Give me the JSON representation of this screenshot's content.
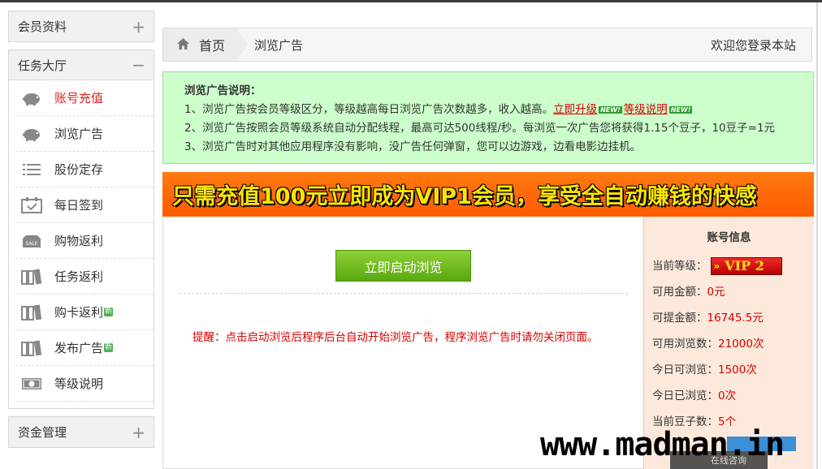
{
  "sidebar": {
    "member_panel": {
      "title": "会员资料",
      "toggle": "+"
    },
    "task_panel": {
      "title": "任务大厅",
      "toggle": "−",
      "items": [
        {
          "label": "账号充值",
          "icon": "piggy-bank-icon",
          "new": ""
        },
        {
          "label": "浏览广告",
          "icon": "piggy-bank-icon",
          "new": ""
        },
        {
          "label": "股份定存",
          "icon": "list-icon",
          "new": ""
        },
        {
          "label": "每日签到",
          "icon": "calendar-check-icon",
          "new": ""
        },
        {
          "label": "购物返利",
          "icon": "sale-tag-icon",
          "new": ""
        },
        {
          "label": "任务返利",
          "icon": "books-icon",
          "new": ""
        },
        {
          "label": "购卡返利",
          "icon": "books-icon",
          "new": "新"
        },
        {
          "label": "发布广告",
          "icon": "books-icon",
          "new": "新"
        },
        {
          "label": "等级说明",
          "icon": "money-bill-icon",
          "new": ""
        }
      ]
    },
    "funds_panel": {
      "title": "资金管理",
      "toggle": "+"
    }
  },
  "breadcrumb": {
    "home": "首页",
    "current": "浏览广告",
    "welcome": "欢迎您登录本站"
  },
  "notice": {
    "title": "浏览广告说明：",
    "line1": "1、浏览广告按会员等级区分，等级越高每日浏览广告次数越多，收入越高。",
    "upgrade_link": "立即升级",
    "level_link": "等级说明",
    "new_tag": "NEW!",
    "line2": "2、浏览广告按照会员等级系统自动分配线程，最高可达500线程/秒。每浏览一次广告您将获得1.15个豆子，10豆子=1元",
    "line3": "3、浏览广告时对其他应用程序没有影响，没广告任何弹窗，您可以边游戏，边看电影边挂机。"
  },
  "banner": {
    "text": "只需充值100元立即成为VIP1会员，享受全自动赚钱的快感"
  },
  "main": {
    "start_button": "立即启动浏览",
    "reminder": "提醒：点击启动浏览后程序后台自动开始浏览广告，程序浏览广告时请勿关闭页面。"
  },
  "account": {
    "title": "账号信息",
    "level_label": "当前等级：",
    "level_badge_arrow": "»",
    "level_badge": "VIP 2",
    "available_label": "可用金额：",
    "available_value": "0元",
    "withdrawable_label": "可提金额：",
    "withdrawable_value": "16745.5元",
    "views_label": "可用浏览数：",
    "views_value": "21000次",
    "daily_label": "今日可浏览：",
    "daily_value": "1500次",
    "browsed_label": "今日已浏览：",
    "browsed_value": "0次",
    "beans_label": "当前豆子数：",
    "beans_value": "5个"
  },
  "overlay": {
    "watermark": "www.madman.in",
    "chat_chip": "在线咨询"
  },
  "colors": {
    "accent_red": "#d40000",
    "notice_bg": "#ccffcc",
    "banner_bg": "#ff6a00",
    "banner_text": "#ffe600",
    "button_green": "#6cb81e",
    "account_bg": "#fde9db"
  }
}
